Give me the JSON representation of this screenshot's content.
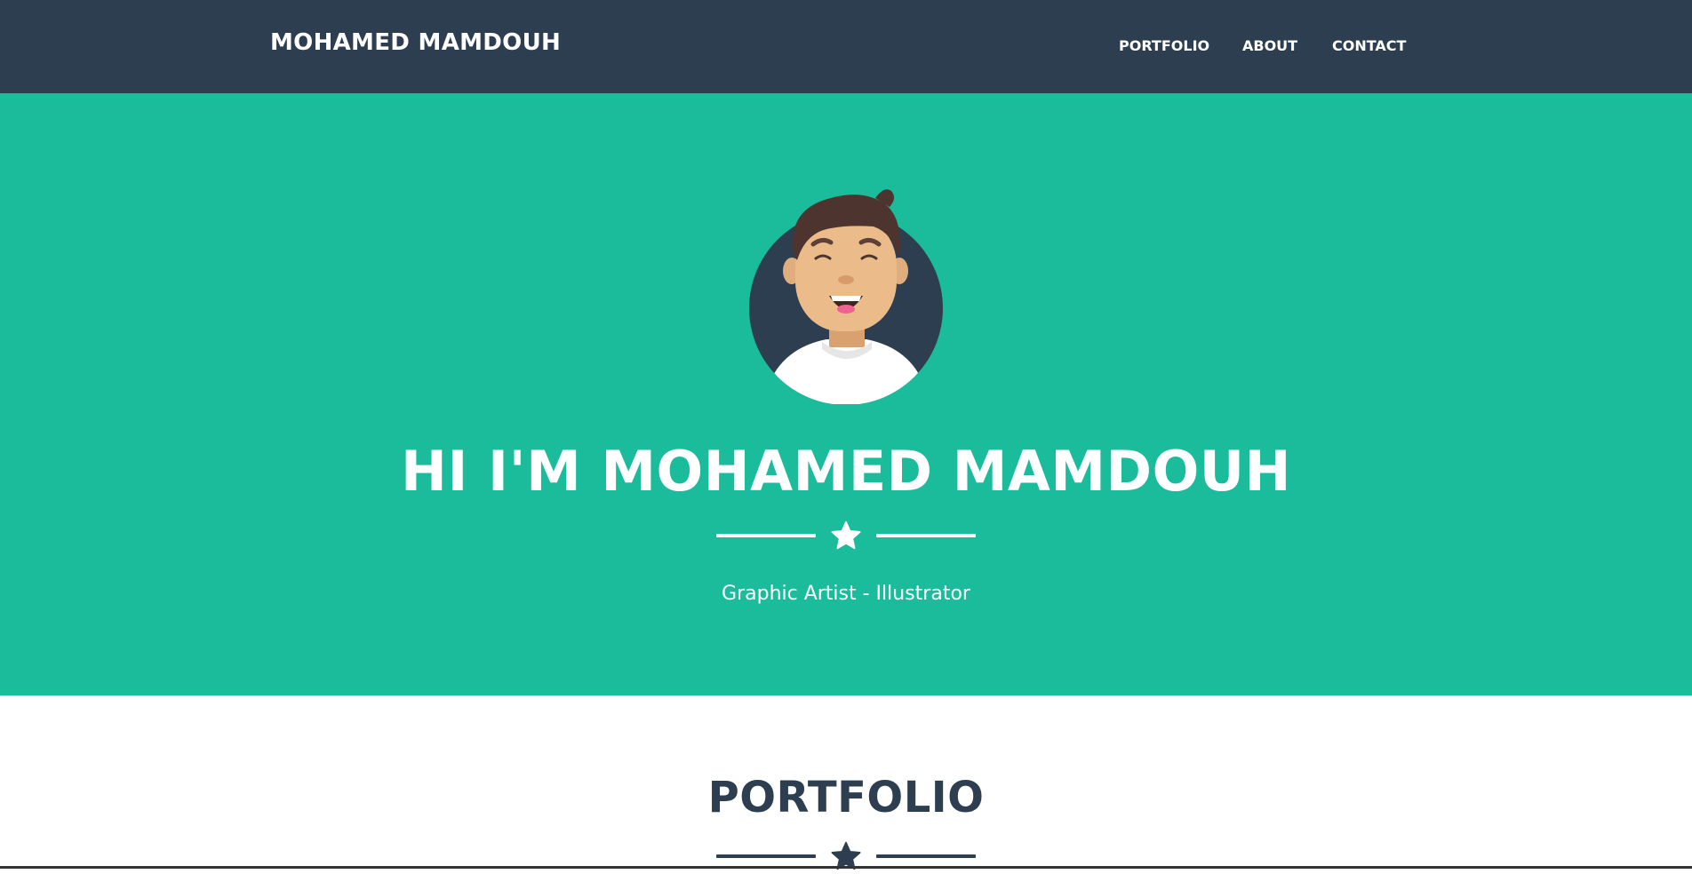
{
  "navbar": {
    "brand": "MOHAMED MAMDOUH",
    "links": [
      "PORTFOLIO",
      "ABOUT",
      "CONTACT"
    ]
  },
  "masthead": {
    "title": "HI I'M MOHAMED MAMDOUH",
    "subtitle": "Graphic Artist - Illustrator",
    "divider_icon": "star-icon"
  },
  "portfolio": {
    "title": "PORTFOLIO",
    "divider_icon": "star-icon"
  },
  "colors": {
    "navbar_bg": "#2c3e50",
    "masthead_bg": "#1abc9c",
    "text_light": "#ffffff",
    "text_dark": "#2c3e50"
  }
}
